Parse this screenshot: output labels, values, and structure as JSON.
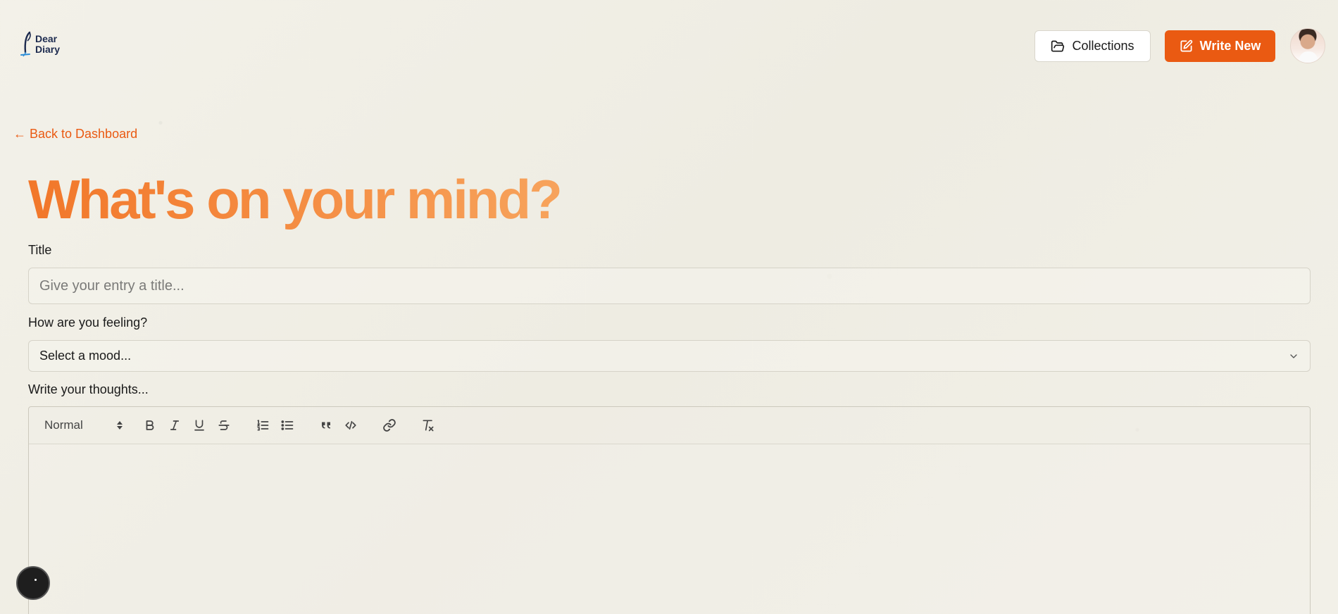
{
  "header": {
    "logo_line1": "Dear",
    "logo_line2": "Diary",
    "collections_label": "Collections",
    "write_new_label": "Write New"
  },
  "nav": {
    "back_label": "← Back to Dashboard"
  },
  "page": {
    "title": "What's on your mind?"
  },
  "form": {
    "title_label": "Title",
    "title_placeholder": "Give your entry a title...",
    "title_value": "",
    "mood_label": "How are you feeling?",
    "mood_selected": "Select a mood...",
    "content_label": "Write your thoughts..."
  },
  "editor": {
    "heading_select": "Normal",
    "tools": [
      "bold",
      "italic",
      "underline",
      "strike",
      "ordered-list",
      "bullet-list",
      "blockquote",
      "code-block",
      "link",
      "clean"
    ]
  },
  "colors": {
    "accent": "#ea5a12",
    "title_gradient_start": "#f2772a",
    "title_gradient_end": "#f7a35c",
    "background": "#f1efe6"
  }
}
